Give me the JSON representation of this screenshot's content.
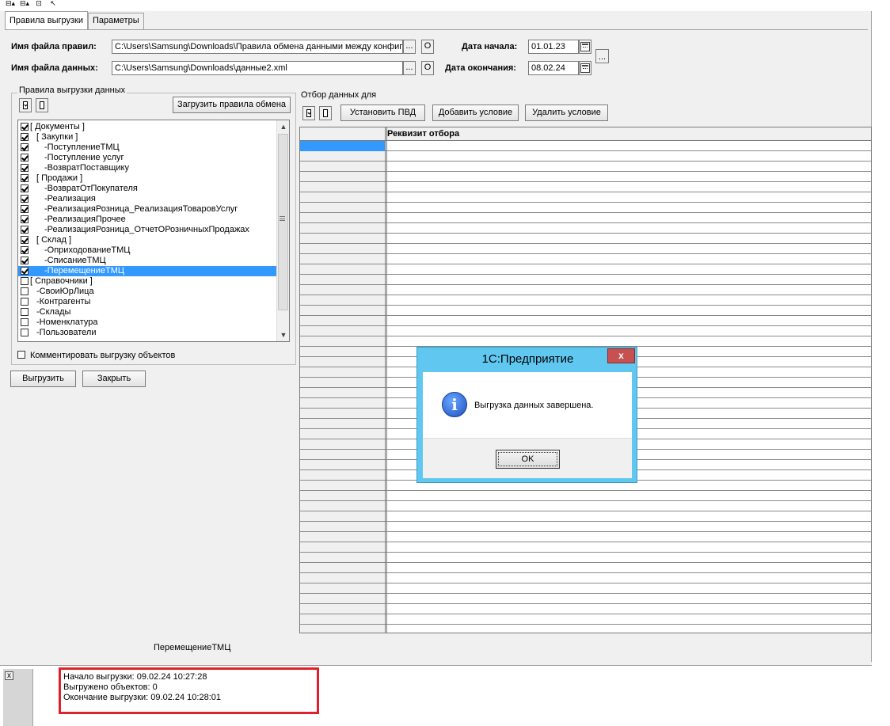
{
  "top_toolbar": {
    "icons": [
      "sort-asc-icon",
      "sort-desc-icon",
      "window-icon",
      "cursor-icon"
    ]
  },
  "tabs": [
    {
      "label": "Правила выгрузки",
      "active": true
    },
    {
      "label": "Параметры",
      "active": false
    }
  ],
  "form": {
    "rules_file_label": "Имя файла правил:",
    "rules_file_value": "C:\\Users\\Samsung\\Downloads\\Правила обмена данными между конфиг",
    "data_file_label": "Имя файла данных:",
    "data_file_value": "C:\\Users\\Samsung\\Downloads\\данные2.xml",
    "browse_label": "...",
    "open_label": "О",
    "start_date_label": "Дата начала:",
    "start_date_value": "01.01.23",
    "end_date_label": "Дата окончания:",
    "end_date_value": "08.02.24",
    "period_button_label": "..."
  },
  "rules_group": {
    "title": "Правила выгрузки данных",
    "load_button": "Загрузить правила обмена",
    "comment_checkbox_label": "Комментировать выгрузку объектов",
    "comment_checked": false
  },
  "tree": [
    {
      "label": "[ Документы ]",
      "checked": true,
      "level": 0
    },
    {
      "label": "[ Закупки ]",
      "checked": true,
      "level": 1
    },
    {
      "label": "-ПоступлениеТМЦ",
      "checked": true,
      "level": 2
    },
    {
      "label": "-Поступление услуг",
      "checked": true,
      "level": 2
    },
    {
      "label": "-ВозвратПоставщику",
      "checked": true,
      "level": 2
    },
    {
      "label": "[ Продажи ]",
      "checked": true,
      "level": 1
    },
    {
      "label": "-ВозвратОтПокупателя",
      "checked": true,
      "level": 2
    },
    {
      "label": "-Реализация",
      "checked": true,
      "level": 2
    },
    {
      "label": "-РеализацияРозница_РеализацияТоваровУслуг",
      "checked": true,
      "level": 2
    },
    {
      "label": "-РеализацияПрочее",
      "checked": true,
      "level": 2
    },
    {
      "label": "-РеализацияРозница_ОтчетОРозничныхПродажах",
      "checked": true,
      "level": 2
    },
    {
      "label": "[ Склад ]",
      "checked": true,
      "level": 1
    },
    {
      "label": "-ОприходованиеТМЦ",
      "checked": true,
      "level": 2
    },
    {
      "label": "-СписаниеТМЦ",
      "checked": true,
      "level": 2
    },
    {
      "label": "-ПеремещениеТМЦ",
      "checked": true,
      "level": 2,
      "selected": true
    },
    {
      "label": "[ Справочники ]",
      "checked": false,
      "level": 0
    },
    {
      "label": "-СвоиЮрЛица",
      "checked": false,
      "level": 1
    },
    {
      "label": "-Контрагенты",
      "checked": false,
      "level": 1
    },
    {
      "label": "-Склады",
      "checked": false,
      "level": 1
    },
    {
      "label": "-Номенклатура",
      "checked": false,
      "level": 1
    },
    {
      "label": "-Пользователи",
      "checked": false,
      "level": 1
    }
  ],
  "actions": {
    "export_button": "Выгрузить",
    "close_button": "Закрыть"
  },
  "filter": {
    "title": "Отбор данных для",
    "set_pvd_button": "Установить ПВД",
    "add_condition_button": "Добавить условие",
    "delete_condition_button": "Удалить условие",
    "column_header": "Реквизит отбора"
  },
  "status": {
    "current_rule": "ПеремещениеТМЦ"
  },
  "modal": {
    "title": "1С:Предприятие",
    "close_label": "x",
    "message": "Выгрузка данных завершена.",
    "ok_label": "OK"
  },
  "log": {
    "close_label": "x",
    "lines": [
      "Начало выгрузки:   09.02.24 10:27:28",
      "Выгружено объектов:   0",
      "Окончание выгрузки:   09.02.24 10:28:01"
    ]
  },
  "colors": {
    "selection": "#3399ff",
    "modal_frame": "#60c8f0",
    "close_red": "#c75050",
    "log_highlight": "#e0202a"
  }
}
